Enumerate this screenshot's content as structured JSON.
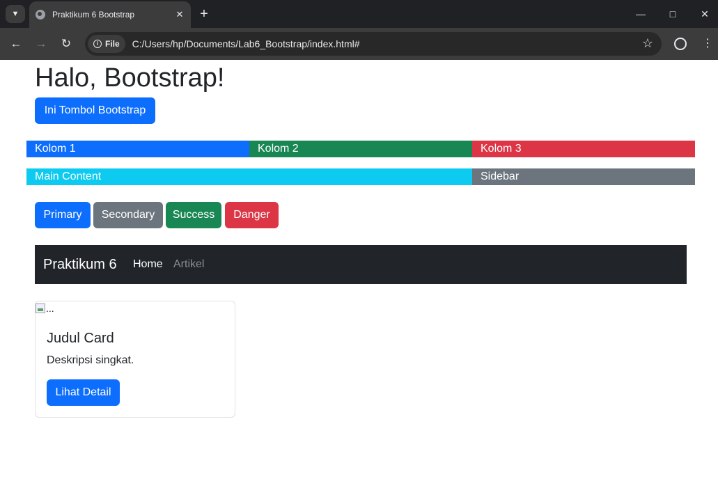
{
  "browser": {
    "tab_title": "Praktikum 6 Bootstrap",
    "site_chip": "File",
    "url": "C:/Users/hp/Documents/Lab6_Bootstrap/index.html#"
  },
  "page": {
    "heading": "Halo, Bootstrap!",
    "hero_button": "Ini Tombol Bootstrap",
    "grid_row": [
      "Kolom 1",
      "Kolom 2",
      "Kolom 3"
    ],
    "layout_row": {
      "main": "Main Content",
      "sidebar": "Sidebar"
    },
    "buttons": [
      "Primary",
      "Secondary",
      "Success",
      "Danger"
    ],
    "navbar": {
      "brand": "Praktikum 6",
      "links": [
        "Home",
        "Artikel"
      ]
    },
    "card": {
      "img_alt": "...",
      "title": "Judul Card",
      "text": "Deskripsi singkat.",
      "button": "Lihat Detail"
    }
  },
  "colors": {
    "primary": "#0d6efd",
    "secondary": "#6c757d",
    "success": "#198754",
    "danger": "#dc3545",
    "info": "#0dcaf0",
    "dark": "#212529"
  }
}
